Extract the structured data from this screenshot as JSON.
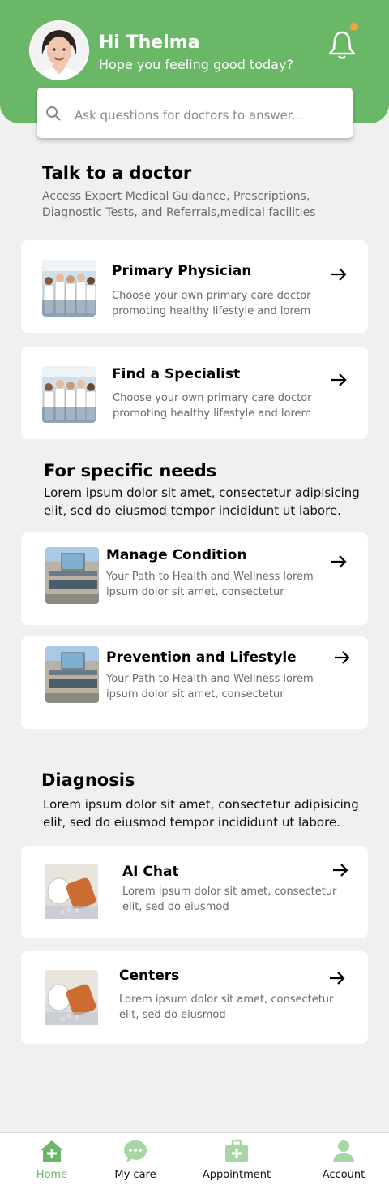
{
  "header": {
    "greeting": "Hi Thelma",
    "subtitle": "Hope you feeling good today?",
    "accent_color": "#6ab867",
    "notification_dot_color": "#f4a23a"
  },
  "search": {
    "placeholder": "Ask questions for doctors to answer..."
  },
  "talk_to_doctor": {
    "title": "Talk to a doctor",
    "description_line1": "Access Expert Medical Guidance, Prescriptions,",
    "description_line2": "Diagnostic Tests, and Referrals,medical facilities",
    "cards": [
      {
        "title": "Primary Physician",
        "desc_line1": "Choose your own primary care doctor",
        "desc_line2": "promoting healthy lifestyle and lorem",
        "icon": "doctors-group-photo"
      },
      {
        "title": "Find a Specialist",
        "desc_line1": "Choose your own primary care doctor",
        "desc_line2": "promoting healthy lifestyle and lorem",
        "icon": "doctors-group-photo"
      }
    ]
  },
  "specific_needs": {
    "title": "For specific needs",
    "body_line1": "Lorem ipsum dolor sit amet, consectetur adipisicing",
    "body_line2": "elit, sed do eiusmod tempor incididunt ut labore.",
    "cards": [
      {
        "title": "Manage Condition",
        "desc_line1": "Your Path to Health and Wellness lorem",
        "desc_line2": "ipsum dolor sit amet, consectetur",
        "icon": "hospital-building-photo"
      },
      {
        "title": "Prevention and Lifestyle",
        "desc_line1": "Your Path to Health and Wellness lorem",
        "desc_line2": "ipsum dolor sit amet, consectetur",
        "icon": "hospital-building-photo"
      }
    ]
  },
  "diagnosis": {
    "title": "Diagnosis",
    "body_line1": "Lorem ipsum dolor sit amet, consectetur adipisicing",
    "body_line2": "elit, sed do eiusmod tempor incididunt ut labore.",
    "cards": [
      {
        "title": "AI Chat",
        "desc_line1": "Lorem ipsum dolor sit amet, consectetur",
        "desc_line2": "elit, sed do eiusmod",
        "icon": "pill-bottle-photo"
      },
      {
        "title": "Centers",
        "desc_line1": "Lorem ipsum dolor sit amet, consectetur",
        "desc_line2": "elit, sed do eiusmod",
        "icon": "pill-bottle-photo"
      }
    ]
  },
  "bottom_nav": {
    "items": [
      {
        "label": "Home",
        "icon": "home-plus-icon",
        "active": true
      },
      {
        "label": "My care",
        "icon": "chat-bubble-icon",
        "active": false
      },
      {
        "label": "Appointment",
        "icon": "medical-kit-icon",
        "active": false
      },
      {
        "label": "Account",
        "icon": "user-icon",
        "active": false
      }
    ]
  }
}
